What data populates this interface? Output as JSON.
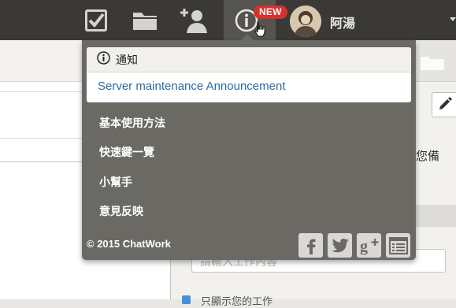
{
  "topbar": {
    "new_badge": "NEW",
    "user_name": "阿湯",
    "icons": [
      "task-check-icon",
      "folder-icon",
      "add-contact-icon",
      "info-icon",
      "cursor-icon",
      "avatar"
    ]
  },
  "background": {
    "right_text": "您備",
    "input_placeholder": "請輸入工作內容",
    "checkbox_text": "只顯示您的工作"
  },
  "dropdown": {
    "notice_title": "通知",
    "notice_link": "Server maintenance Announcement",
    "menu": [
      {
        "label": "基本使用方法"
      },
      {
        "label": "快速鍵一覽"
      },
      {
        "label": "小幫手"
      },
      {
        "label": "意見反映"
      }
    ],
    "copyright": "© 2015 ChatWork",
    "social": [
      "facebook-icon",
      "twitter-icon",
      "google-plus-icon",
      "blog-icon"
    ]
  },
  "colors": {
    "topbar_bg": "#3a3935",
    "dropdown_bg": "#6a6964",
    "link": "#2b6a9e",
    "badge": "#d8302d"
  }
}
